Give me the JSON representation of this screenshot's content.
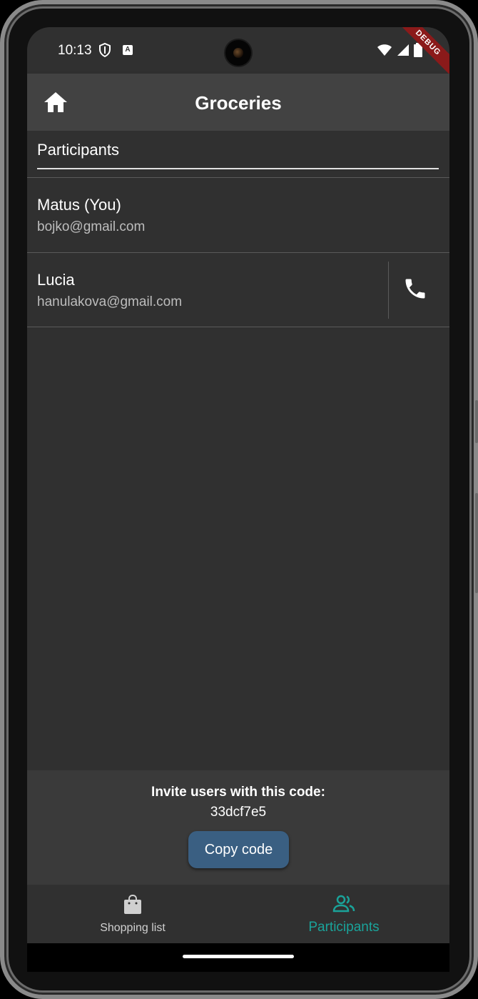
{
  "status_bar": {
    "time": "10:13",
    "debug_label": "DEBUG"
  },
  "app_bar": {
    "title": "Groceries",
    "home_icon": "home-icon"
  },
  "participants": {
    "section_title": "Participants",
    "items": [
      {
        "name": "Matus (You)",
        "email": "bojko@gmail.com",
        "has_call": false
      },
      {
        "name": "Lucia",
        "email": "hanulakova@gmail.com",
        "has_call": true
      }
    ]
  },
  "invite": {
    "label": "Invite users with this code:",
    "code": "33dcf7e5",
    "copy_button": "Copy code"
  },
  "bottom_nav": {
    "items": [
      {
        "label": "Shopping list",
        "icon": "shopping-bag-icon",
        "active": false
      },
      {
        "label": "Participants",
        "icon": "people-icon",
        "active": true
      }
    ]
  },
  "colors": {
    "background": "#303030",
    "app_bar": "#424242",
    "accent": "#1aa39a",
    "button": "#3a5f82",
    "debug_ribbon": "#8b1a1a"
  }
}
